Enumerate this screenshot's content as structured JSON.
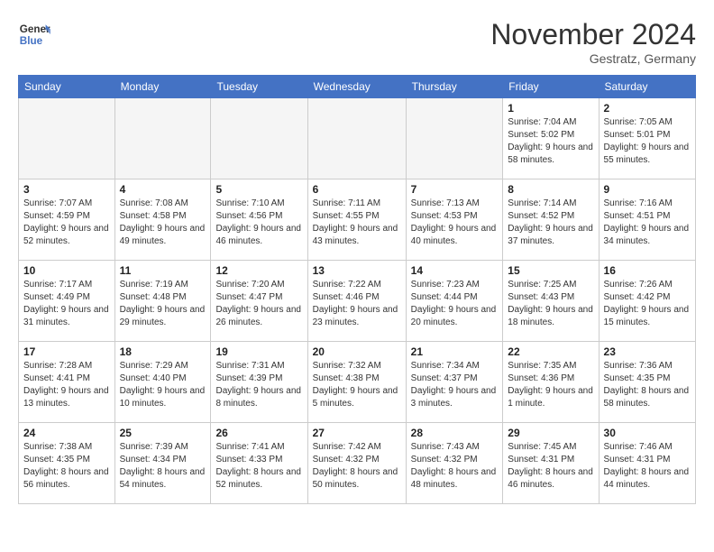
{
  "logo": {
    "line1": "General",
    "line2": "Blue"
  },
  "title": "November 2024",
  "location": "Gestratz, Germany",
  "days_of_week": [
    "Sunday",
    "Monday",
    "Tuesday",
    "Wednesday",
    "Thursday",
    "Friday",
    "Saturday"
  ],
  "weeks": [
    {
      "days": [
        {
          "num": "",
          "info": ""
        },
        {
          "num": "",
          "info": ""
        },
        {
          "num": "",
          "info": ""
        },
        {
          "num": "",
          "info": ""
        },
        {
          "num": "",
          "info": ""
        },
        {
          "num": "1",
          "info": "Sunrise: 7:04 AM\nSunset: 5:02 PM\nDaylight: 9 hours and 58 minutes."
        },
        {
          "num": "2",
          "info": "Sunrise: 7:05 AM\nSunset: 5:01 PM\nDaylight: 9 hours and 55 minutes."
        }
      ]
    },
    {
      "days": [
        {
          "num": "3",
          "info": "Sunrise: 7:07 AM\nSunset: 4:59 PM\nDaylight: 9 hours and 52 minutes."
        },
        {
          "num": "4",
          "info": "Sunrise: 7:08 AM\nSunset: 4:58 PM\nDaylight: 9 hours and 49 minutes."
        },
        {
          "num": "5",
          "info": "Sunrise: 7:10 AM\nSunset: 4:56 PM\nDaylight: 9 hours and 46 minutes."
        },
        {
          "num": "6",
          "info": "Sunrise: 7:11 AM\nSunset: 4:55 PM\nDaylight: 9 hours and 43 minutes."
        },
        {
          "num": "7",
          "info": "Sunrise: 7:13 AM\nSunset: 4:53 PM\nDaylight: 9 hours and 40 minutes."
        },
        {
          "num": "8",
          "info": "Sunrise: 7:14 AM\nSunset: 4:52 PM\nDaylight: 9 hours and 37 minutes."
        },
        {
          "num": "9",
          "info": "Sunrise: 7:16 AM\nSunset: 4:51 PM\nDaylight: 9 hours and 34 minutes."
        }
      ]
    },
    {
      "days": [
        {
          "num": "10",
          "info": "Sunrise: 7:17 AM\nSunset: 4:49 PM\nDaylight: 9 hours and 31 minutes."
        },
        {
          "num": "11",
          "info": "Sunrise: 7:19 AM\nSunset: 4:48 PM\nDaylight: 9 hours and 29 minutes."
        },
        {
          "num": "12",
          "info": "Sunrise: 7:20 AM\nSunset: 4:47 PM\nDaylight: 9 hours and 26 minutes."
        },
        {
          "num": "13",
          "info": "Sunrise: 7:22 AM\nSunset: 4:46 PM\nDaylight: 9 hours and 23 minutes."
        },
        {
          "num": "14",
          "info": "Sunrise: 7:23 AM\nSunset: 4:44 PM\nDaylight: 9 hours and 20 minutes."
        },
        {
          "num": "15",
          "info": "Sunrise: 7:25 AM\nSunset: 4:43 PM\nDaylight: 9 hours and 18 minutes."
        },
        {
          "num": "16",
          "info": "Sunrise: 7:26 AM\nSunset: 4:42 PM\nDaylight: 9 hours and 15 minutes."
        }
      ]
    },
    {
      "days": [
        {
          "num": "17",
          "info": "Sunrise: 7:28 AM\nSunset: 4:41 PM\nDaylight: 9 hours and 13 minutes."
        },
        {
          "num": "18",
          "info": "Sunrise: 7:29 AM\nSunset: 4:40 PM\nDaylight: 9 hours and 10 minutes."
        },
        {
          "num": "19",
          "info": "Sunrise: 7:31 AM\nSunset: 4:39 PM\nDaylight: 9 hours and 8 minutes."
        },
        {
          "num": "20",
          "info": "Sunrise: 7:32 AM\nSunset: 4:38 PM\nDaylight: 9 hours and 5 minutes."
        },
        {
          "num": "21",
          "info": "Sunrise: 7:34 AM\nSunset: 4:37 PM\nDaylight: 9 hours and 3 minutes."
        },
        {
          "num": "22",
          "info": "Sunrise: 7:35 AM\nSunset: 4:36 PM\nDaylight: 9 hours and 1 minute."
        },
        {
          "num": "23",
          "info": "Sunrise: 7:36 AM\nSunset: 4:35 PM\nDaylight: 8 hours and 58 minutes."
        }
      ]
    },
    {
      "days": [
        {
          "num": "24",
          "info": "Sunrise: 7:38 AM\nSunset: 4:35 PM\nDaylight: 8 hours and 56 minutes."
        },
        {
          "num": "25",
          "info": "Sunrise: 7:39 AM\nSunset: 4:34 PM\nDaylight: 8 hours and 54 minutes."
        },
        {
          "num": "26",
          "info": "Sunrise: 7:41 AM\nSunset: 4:33 PM\nDaylight: 8 hours and 52 minutes."
        },
        {
          "num": "27",
          "info": "Sunrise: 7:42 AM\nSunset: 4:32 PM\nDaylight: 8 hours and 50 minutes."
        },
        {
          "num": "28",
          "info": "Sunrise: 7:43 AM\nSunset: 4:32 PM\nDaylight: 8 hours and 48 minutes."
        },
        {
          "num": "29",
          "info": "Sunrise: 7:45 AM\nSunset: 4:31 PM\nDaylight: 8 hours and 46 minutes."
        },
        {
          "num": "30",
          "info": "Sunrise: 7:46 AM\nSunset: 4:31 PM\nDaylight: 8 hours and 44 minutes."
        }
      ]
    }
  ]
}
